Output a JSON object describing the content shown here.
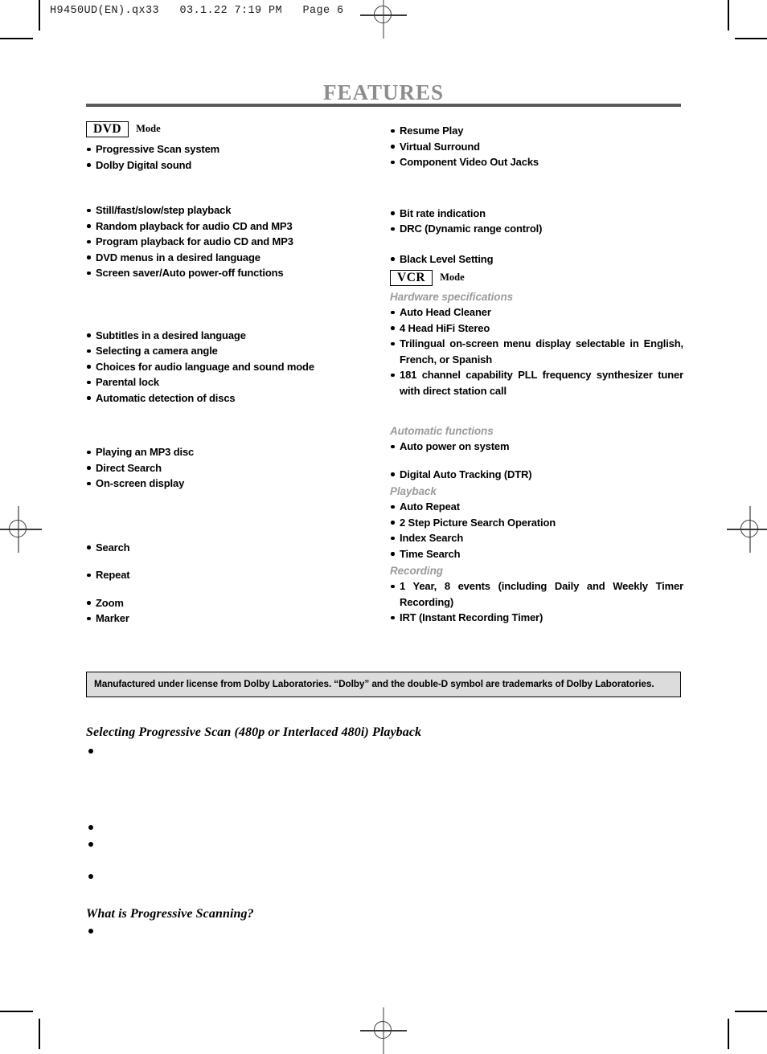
{
  "header": {
    "filename_line": "H9450UD(EN).qx33   03.1.22 7:19 PM   Page 6"
  },
  "title": "FEATURES",
  "colors": {
    "title_gray": "#8d8d8d",
    "rule_gray": "#5a5a5a",
    "sub_label_gray": "#9b9b9b",
    "notice_bg": "#dcdcdc",
    "text_black": "#000000"
  },
  "left_column": {
    "mode": {
      "chip": "DVD",
      "word": "Mode"
    },
    "group1": [
      "Progressive Scan system",
      "Dolby Digital sound"
    ],
    "group2": [
      "Still/fast/slow/step playback",
      "Random playback for audio CD and MP3",
      "Program playback for audio CD and MP3",
      "DVD menus in a desired language",
      "Screen saver/Auto power-off functions"
    ],
    "group3": [
      "Subtitles in a desired language",
      "Selecting a camera angle",
      "Choices for audio language and sound mode",
      "Parental lock",
      "Automatic detection of discs"
    ],
    "group4": [
      "Playing an MP3 disc",
      "Direct Search",
      "On-screen display"
    ],
    "group5": [
      "Search",
      "Repeat",
      "Zoom",
      "Marker"
    ]
  },
  "right_column": {
    "group1": [
      "Resume Play",
      "Virtual Surround",
      "Component Video Out Jacks"
    ],
    "group2": [
      "Bit rate indication",
      "DRC (Dynamic range control)"
    ],
    "group3": [
      "Black Level Setting"
    ],
    "mode": {
      "chip": "VCR",
      "word": "Mode"
    },
    "section_hardware": {
      "label": "Hardware specifications",
      "items": [
        "Auto Head Cleaner",
        "4 Head HiFi Stereo",
        "Trilingual on-screen menu display selectable in English, French, or Spanish",
        "181 channel capability PLL frequency synthesizer tuner with direct station call"
      ]
    },
    "section_automatic": {
      "label": "Automatic functions",
      "items": [
        "Auto power on system",
        "Digital Auto Tracking (DTR)"
      ]
    },
    "section_playback": {
      "label": "Playback",
      "items": [
        "Auto Repeat",
        "2 Step Picture Search Operation",
        "Index Search",
        "Time Search"
      ]
    },
    "section_recording": {
      "label": "Recording",
      "items": [
        "1 Year, 8 events (including Daily and Weekly Timer Recording)",
        "IRT (Instant Recording Timer)"
      ]
    }
  },
  "notice": "Manufactured under license from Dolby Laboratories. “Dolby” and the double-D symbol are trademarks of Dolby Laboratories.",
  "bottom_sections": [
    {
      "heading": "Selecting Progressive Scan (480p or Interlaced 480i) Playback"
    },
    {
      "heading": "What is Progressive Scanning?"
    }
  ]
}
